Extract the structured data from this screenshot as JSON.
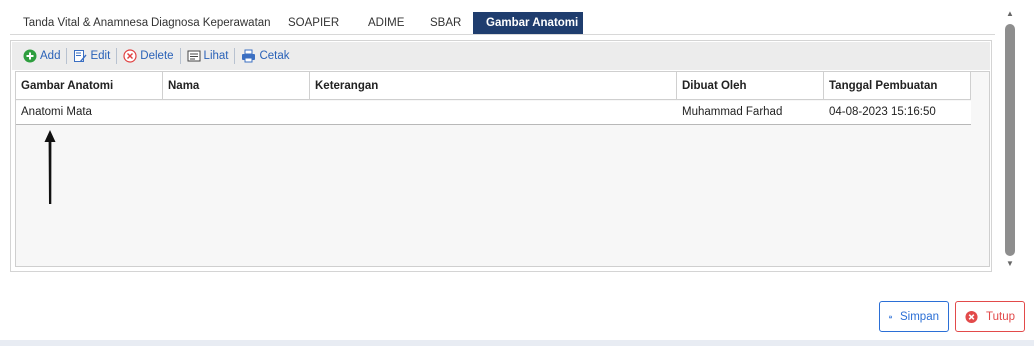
{
  "tabs": [
    {
      "label": "Tanda Vital & Anamnesa",
      "active": false
    },
    {
      "label": "Diagnosa Keperawatan",
      "active": false
    },
    {
      "label": "SOAPIER",
      "active": false
    },
    {
      "label": "ADIME",
      "active": false
    },
    {
      "label": "SBAR",
      "active": false
    },
    {
      "label": "Gambar Anatomi",
      "active": true
    }
  ],
  "toolbar": {
    "add_label": "Add",
    "edit_label": "Edit",
    "delete_label": "Delete",
    "lihat_label": "Lihat",
    "cetak_label": "Cetak"
  },
  "table": {
    "columns": [
      "Gambar Anatomi",
      "Nama",
      "Keterangan",
      "Dibuat Oleh",
      "Tanggal Pembuatan"
    ],
    "rows": [
      [
        "Anatomi Mata",
        "",
        "",
        "Muhammad Farhad",
        "04-08-2023 15:16:50"
      ]
    ]
  },
  "footer": {
    "simpan_label": "Simpan",
    "tutup_label": "Tutup"
  },
  "colors": {
    "active_tab": "#1f3d6e",
    "toolbar_link": "#2a62b8",
    "save_button": "#2b6fd6",
    "close_button": "#e24a4a",
    "add_icon": "#2e9e3e"
  }
}
